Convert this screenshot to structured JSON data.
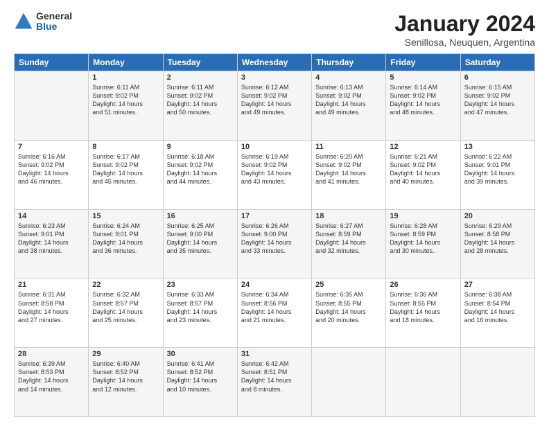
{
  "logo": {
    "general": "General",
    "blue": "Blue"
  },
  "title": "January 2024",
  "subtitle": "Senillosa, Neuquen, Argentina",
  "weekdays": [
    "Sunday",
    "Monday",
    "Tuesday",
    "Wednesday",
    "Thursday",
    "Friday",
    "Saturday"
  ],
  "weeks": [
    [
      {
        "day": "",
        "info": ""
      },
      {
        "day": "1",
        "info": "Sunrise: 6:11 AM\nSunset: 9:02 PM\nDaylight: 14 hours\nand 51 minutes."
      },
      {
        "day": "2",
        "info": "Sunrise: 6:11 AM\nSunset: 9:02 PM\nDaylight: 14 hours\nand 50 minutes."
      },
      {
        "day": "3",
        "info": "Sunrise: 6:12 AM\nSunset: 9:02 PM\nDaylight: 14 hours\nand 49 minutes."
      },
      {
        "day": "4",
        "info": "Sunrise: 6:13 AM\nSunset: 9:02 PM\nDaylight: 14 hours\nand 49 minutes."
      },
      {
        "day": "5",
        "info": "Sunrise: 6:14 AM\nSunset: 9:02 PM\nDaylight: 14 hours\nand 48 minutes."
      },
      {
        "day": "6",
        "info": "Sunrise: 6:15 AM\nSunset: 9:02 PM\nDaylight: 14 hours\nand 47 minutes."
      }
    ],
    [
      {
        "day": "7",
        "info": "Sunrise: 6:16 AM\nSunset: 9:02 PM\nDaylight: 14 hours\nand 46 minutes."
      },
      {
        "day": "8",
        "info": "Sunrise: 6:17 AM\nSunset: 9:02 PM\nDaylight: 14 hours\nand 45 minutes."
      },
      {
        "day": "9",
        "info": "Sunrise: 6:18 AM\nSunset: 9:02 PM\nDaylight: 14 hours\nand 44 minutes."
      },
      {
        "day": "10",
        "info": "Sunrise: 6:19 AM\nSunset: 9:02 PM\nDaylight: 14 hours\nand 43 minutes."
      },
      {
        "day": "11",
        "info": "Sunrise: 6:20 AM\nSunset: 9:02 PM\nDaylight: 14 hours\nand 41 minutes."
      },
      {
        "day": "12",
        "info": "Sunrise: 6:21 AM\nSunset: 9:02 PM\nDaylight: 14 hours\nand 40 minutes."
      },
      {
        "day": "13",
        "info": "Sunrise: 6:22 AM\nSunset: 9:01 PM\nDaylight: 14 hours\nand 39 minutes."
      }
    ],
    [
      {
        "day": "14",
        "info": "Sunrise: 6:23 AM\nSunset: 9:01 PM\nDaylight: 14 hours\nand 38 minutes."
      },
      {
        "day": "15",
        "info": "Sunrise: 6:24 AM\nSunset: 9:01 PM\nDaylight: 14 hours\nand 36 minutes."
      },
      {
        "day": "16",
        "info": "Sunrise: 6:25 AM\nSunset: 9:00 PM\nDaylight: 14 hours\nand 35 minutes."
      },
      {
        "day": "17",
        "info": "Sunrise: 6:26 AM\nSunset: 9:00 PM\nDaylight: 14 hours\nand 33 minutes."
      },
      {
        "day": "18",
        "info": "Sunrise: 6:27 AM\nSunset: 8:59 PM\nDaylight: 14 hours\nand 32 minutes."
      },
      {
        "day": "19",
        "info": "Sunrise: 6:28 AM\nSunset: 8:59 PM\nDaylight: 14 hours\nand 30 minutes."
      },
      {
        "day": "20",
        "info": "Sunrise: 6:29 AM\nSunset: 8:58 PM\nDaylight: 14 hours\nand 28 minutes."
      }
    ],
    [
      {
        "day": "21",
        "info": "Sunrise: 6:31 AM\nSunset: 8:58 PM\nDaylight: 14 hours\nand 27 minutes."
      },
      {
        "day": "22",
        "info": "Sunrise: 6:32 AM\nSunset: 8:57 PM\nDaylight: 14 hours\nand 25 minutes."
      },
      {
        "day": "23",
        "info": "Sunrise: 6:33 AM\nSunset: 8:57 PM\nDaylight: 14 hours\nand 23 minutes."
      },
      {
        "day": "24",
        "info": "Sunrise: 6:34 AM\nSunset: 8:56 PM\nDaylight: 14 hours\nand 21 minutes."
      },
      {
        "day": "25",
        "info": "Sunrise: 6:35 AM\nSunset: 8:55 PM\nDaylight: 14 hours\nand 20 minutes."
      },
      {
        "day": "26",
        "info": "Sunrise: 6:36 AM\nSunset: 8:55 PM\nDaylight: 14 hours\nand 18 minutes."
      },
      {
        "day": "27",
        "info": "Sunrise: 6:38 AM\nSunset: 8:54 PM\nDaylight: 14 hours\nand 16 minutes."
      }
    ],
    [
      {
        "day": "28",
        "info": "Sunrise: 6:39 AM\nSunset: 8:53 PM\nDaylight: 14 hours\nand 14 minutes."
      },
      {
        "day": "29",
        "info": "Sunrise: 6:40 AM\nSunset: 8:52 PM\nDaylight: 14 hours\nand 12 minutes."
      },
      {
        "day": "30",
        "info": "Sunrise: 6:41 AM\nSunset: 8:52 PM\nDaylight: 14 hours\nand 10 minutes."
      },
      {
        "day": "31",
        "info": "Sunrise: 6:42 AM\nSunset: 8:51 PM\nDaylight: 14 hours\nand 8 minutes."
      },
      {
        "day": "",
        "info": ""
      },
      {
        "day": "",
        "info": ""
      },
      {
        "day": "",
        "info": ""
      }
    ]
  ]
}
